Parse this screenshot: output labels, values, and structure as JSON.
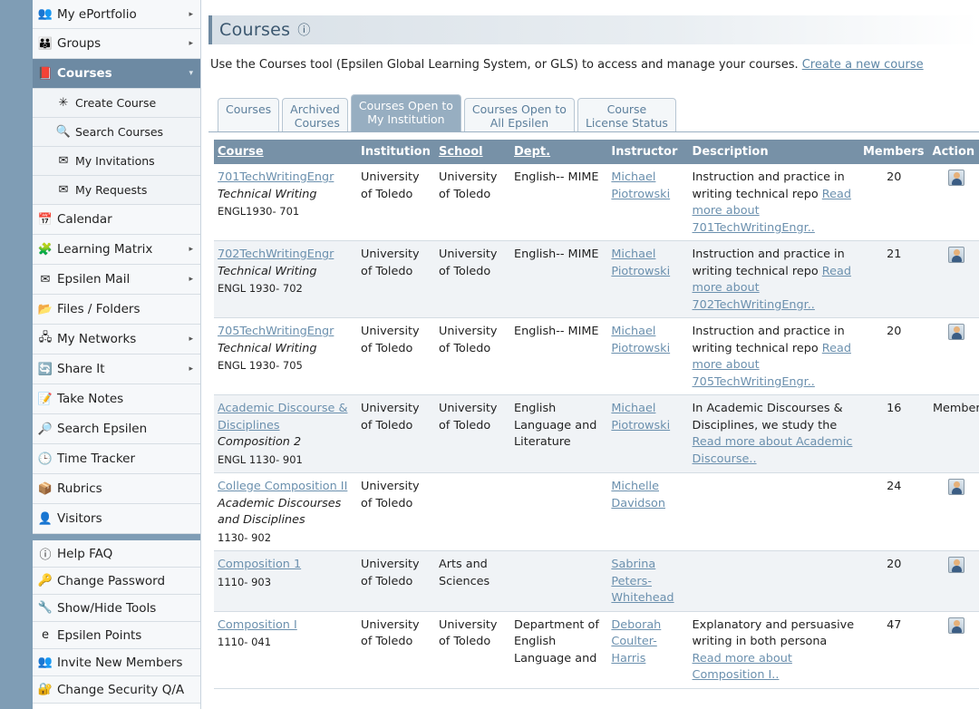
{
  "sidebar": {
    "items": [
      {
        "label": "My ePortfolio",
        "icon": "eportfolio-icon",
        "glyph": "👥",
        "arrow": true
      },
      {
        "label": "Groups",
        "icon": "groups-icon",
        "glyph": "👪",
        "arrow": true
      },
      {
        "label": "Courses",
        "icon": "courses-icon",
        "glyph": "📕",
        "arrow": true,
        "active": true
      },
      {
        "label": "Create Course",
        "icon": "create-course-icon",
        "glyph": "✳",
        "sub": true
      },
      {
        "label": "Search Courses",
        "icon": "search-courses-icon",
        "glyph": "🔍",
        "sub": true
      },
      {
        "label": "My Invitations",
        "icon": "invitations-icon",
        "glyph": "✉",
        "sub": true
      },
      {
        "label": "My Requests",
        "icon": "requests-icon",
        "glyph": "✉",
        "sub": true
      },
      {
        "label": "Calendar",
        "icon": "calendar-icon",
        "glyph": "📅"
      },
      {
        "label": "Learning Matrix",
        "icon": "learning-matrix-icon",
        "glyph": "🧩",
        "arrow": true
      },
      {
        "label": "Epsilen Mail",
        "icon": "mail-icon",
        "glyph": "✉",
        "arrow": true
      },
      {
        "label": "Files / Folders",
        "icon": "folder-icon",
        "glyph": "📂"
      },
      {
        "label": "My Networks",
        "icon": "networks-icon",
        "glyph": "🖧",
        "arrow": true
      },
      {
        "label": "Share It",
        "icon": "share-icon",
        "glyph": "🔄",
        "arrow": true
      },
      {
        "label": "Take Notes",
        "icon": "notes-icon",
        "glyph": "📝"
      },
      {
        "label": "Search Epsilen",
        "icon": "search-epsilen-icon",
        "glyph": "🔎"
      },
      {
        "label": "Time Tracker",
        "icon": "clock-icon",
        "glyph": "🕒"
      },
      {
        "label": "Rubrics",
        "icon": "rubrics-icon",
        "glyph": "📦"
      },
      {
        "label": "Visitors",
        "icon": "visitors-icon",
        "glyph": "👤"
      }
    ],
    "tools": [
      {
        "label": "Help FAQ",
        "icon": "help-icon",
        "glyph": "ⓘ"
      },
      {
        "label": "Change Password",
        "icon": "password-icon",
        "glyph": "🔑"
      },
      {
        "label": "Show/Hide Tools",
        "icon": "tools-icon",
        "glyph": "🔧"
      },
      {
        "label": "Epsilen Points",
        "icon": "points-icon",
        "glyph": "e"
      },
      {
        "label": "Invite New Members",
        "icon": "invite-icon",
        "glyph": "👥"
      },
      {
        "label": "Change Security Q/A",
        "icon": "security-icon",
        "glyph": "🔐"
      }
    ]
  },
  "header": {
    "title": "Courses",
    "help_glyph": "ⓘ"
  },
  "intro": {
    "text": "Use the Courses tool (Epsilen Global Learning System, or GLS) to access and manage your courses. ",
    "link": "Create a new course"
  },
  "tabs": [
    {
      "line1": "Courses",
      "line2": ""
    },
    {
      "line1": "Archived",
      "line2": "Courses"
    },
    {
      "line1": "Courses Open to",
      "line2": "My Institution",
      "active": true
    },
    {
      "line1": "Courses Open to",
      "line2": "All Epsilen"
    },
    {
      "line1": "Course",
      "line2": "License Status"
    }
  ],
  "table": {
    "headers": [
      "Course",
      "Institution",
      "School",
      "Dept.",
      "Instructor",
      "Description",
      "Members",
      "Action"
    ],
    "rows": [
      {
        "course": "701TechWritingEngr",
        "subtitle": "Technical Writing",
        "code": "ENGL1930- 701",
        "institution": "University of Toledo",
        "school": "University of Toledo",
        "dept": "English-- MIME",
        "instructor": "Michael Piotrowski",
        "desc": "Instruction and practice in writing technical repo",
        "more": "Read more about 701TechWritingEngr..",
        "members": "20",
        "action": "avatar"
      },
      {
        "course": "702TechWritingEngr",
        "subtitle": "Technical Writing",
        "code": "ENGL 1930- 702",
        "institution": "University of Toledo",
        "school": "University of Toledo",
        "dept": "English-- MIME",
        "instructor": "Michael Piotrowski",
        "desc": "Instruction and practice in writing technical repo",
        "more": "Read more about 702TechWritingEngr..",
        "members": "21",
        "action": "avatar"
      },
      {
        "course": "705TechWritingEngr",
        "subtitle": "Technical Writing",
        "code": "ENGL 1930- 705",
        "institution": "University of Toledo",
        "school": "University of Toledo",
        "dept": "English-- MIME",
        "instructor": "Michael Piotrowski",
        "desc": "Instruction and practice in writing technical repo",
        "more": "Read more about 705TechWritingEngr..",
        "members": "20",
        "action": "avatar"
      },
      {
        "course": "Academic Discourse & Disciplines",
        "subtitle": "Composition 2",
        "code": "ENGL 1130- 901",
        "institution": "University of Toledo",
        "school": "University of Toledo",
        "dept": "English Language and Literature",
        "instructor": "Michael Piotrowski",
        "desc": "In Academic Discourses & Disciplines, we study the",
        "more": "Read more about Academic Discourse..",
        "members": "16",
        "action": "Member"
      },
      {
        "course": "College Composition II",
        "subtitle": "Academic Discourses and Disciplines",
        "code": "1130- 902",
        "institution": "University of Toledo",
        "school": "",
        "dept": "",
        "instructor": "Michelle Davidson",
        "desc": "",
        "more": "",
        "members": "24",
        "action": "avatar"
      },
      {
        "course": "Composition 1",
        "subtitle": "",
        "code": "1110- 903",
        "institution": "University of Toledo",
        "school": "Arts and Sciences",
        "dept": "",
        "instructor": "Sabrina Peters-Whitehead",
        "desc": "",
        "more": "",
        "members": "20",
        "action": "avatar"
      },
      {
        "course": "Composition I",
        "subtitle": "",
        "code": "1110- 041",
        "institution": "University of Toledo",
        "school": "University of Toledo",
        "dept": "Department of English Language and",
        "instructor": "Deborah Coulter-Harris",
        "desc": "Explanatory and persuasive writing in both persona",
        "more": "Read more about Composition I..",
        "members": "47",
        "action": "avatar"
      }
    ]
  }
}
